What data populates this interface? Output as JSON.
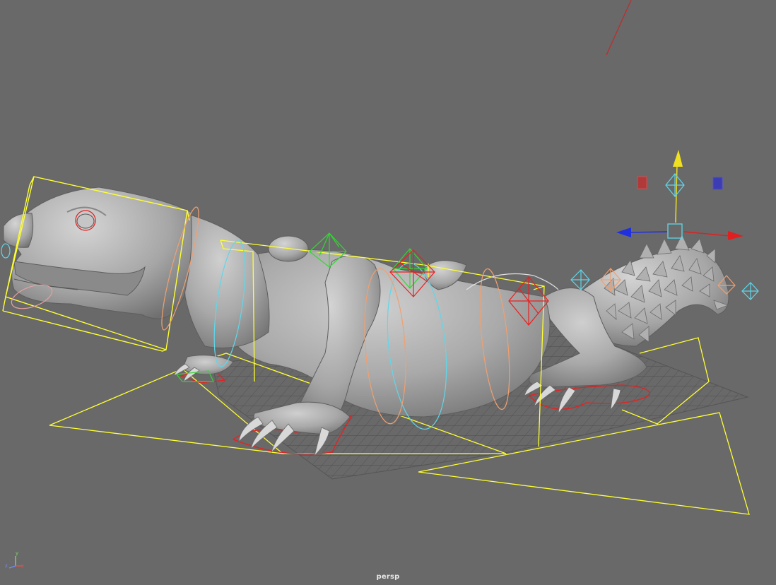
{
  "viewport": {
    "camera_name": "persp",
    "background_color": "#696969",
    "view_type": "perspective 3D viewport"
  },
  "axis_indicator": {
    "x_label": "x",
    "y_label": "y",
    "z_label": "z",
    "x_color": "#e05050",
    "y_color": "#7bd65c",
    "z_color": "#6f8cff"
  },
  "manipulator": {
    "type": "move",
    "x_axis_color": "#e02020",
    "y_axis_color": "#f0e020",
    "z_axis_color": "#2030e0"
  },
  "scene": {
    "model": "lizard-mesh",
    "rig_control_colors": {
      "selected": "#ffff33",
      "cyan": "#5fd7ea",
      "green": "#33d633",
      "red": "#e82020",
      "orange": "#f0a070",
      "white": "#e0e0e0"
    }
  }
}
